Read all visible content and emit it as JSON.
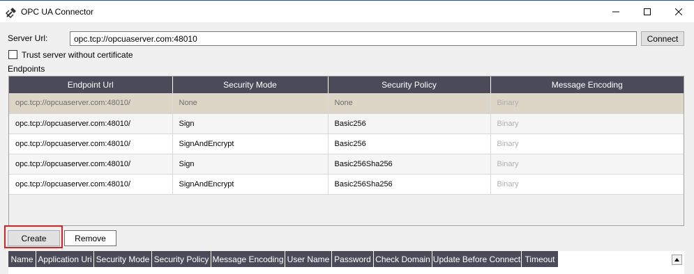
{
  "window": {
    "title": "OPC UA Connector",
    "icon": "plug-icon"
  },
  "connection": {
    "server_url_label": "Server Url:",
    "server_url_value": "opc.tcp://opcuaserver.com:48010",
    "connect_label": "Connect",
    "trust_label": "Trust server without certificate",
    "trust_checked": false
  },
  "endpoints": {
    "label": "Endpoints",
    "columns": [
      "Endpoint Url",
      "Security Mode",
      "Security Policy",
      "Message Encoding"
    ],
    "rows": [
      {
        "url": "opc.tcp://opcuaserver.com:48010/",
        "mode": "None",
        "policy": "None",
        "encoding": "Binary",
        "selected": true
      },
      {
        "url": "opc.tcp://opcuaserver.com:48010/",
        "mode": "Sign",
        "policy": "Basic256",
        "encoding": "Binary"
      },
      {
        "url": "opc.tcp://opcuaserver.com:48010/",
        "mode": "SignAndEncrypt",
        "policy": "Basic256",
        "encoding": "Binary"
      },
      {
        "url": "opc.tcp://opcuaserver.com:48010/",
        "mode": "Sign",
        "policy": "Basic256Sha256",
        "encoding": "Binary"
      },
      {
        "url": "opc.tcp://opcuaserver.com:48010/",
        "mode": "SignAndEncrypt",
        "policy": "Basic256Sha256",
        "encoding": "Binary"
      }
    ]
  },
  "actions": {
    "create_label": "Create",
    "remove_label": "Remove"
  },
  "connections": {
    "columns": [
      "Name",
      "Application Uri",
      "Security Mode",
      "Security Policy",
      "Message Encoding",
      "User Name",
      "Password",
      "Check Domain",
      "Update Before Connect",
      "Timeout"
    ]
  },
  "colors": {
    "header_bg": "#4a4a58",
    "selected_row": "#ddd5c6",
    "highlight": "#e02020"
  }
}
